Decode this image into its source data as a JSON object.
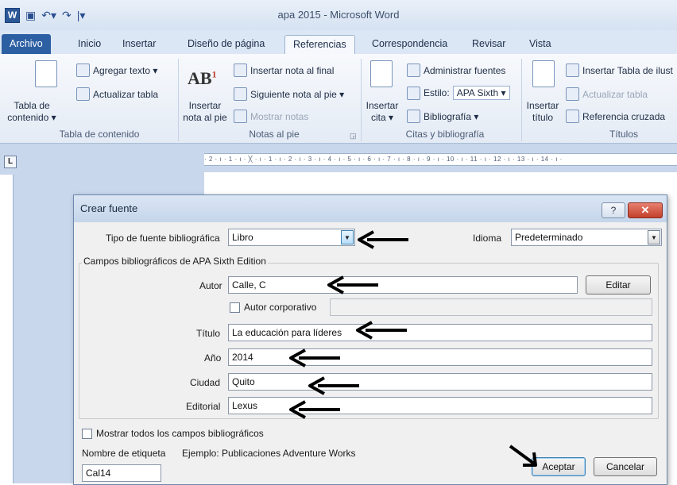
{
  "window": {
    "title": "apa 2015 - Microsoft Word"
  },
  "tabs": [
    {
      "label": "Archivo"
    },
    {
      "label": "Inicio"
    },
    {
      "label": "Insertar"
    },
    {
      "label": "Diseño de página"
    },
    {
      "label": "Referencias"
    },
    {
      "label": "Correspondencia"
    },
    {
      "label": "Revisar"
    },
    {
      "label": "Vista"
    }
  ],
  "ribbon": {
    "toc": {
      "big_line1": "Tabla de",
      "big_line2": "contenido ▾",
      "add_text": "Agregar texto ▾",
      "update_table": "Actualizar tabla",
      "group": "Tabla de contenido"
    },
    "footnotes": {
      "ab": "AB",
      "ab_sup": "1",
      "insert_line1": "Insertar",
      "insert_line2": "nota al pie",
      "insert_endnote": "Insertar nota al final",
      "next_footnote": "Siguiente nota al pie ▾",
      "show_notes": "Mostrar notas",
      "group": "Notas al pie"
    },
    "citations": {
      "insert_line1": "Insertar",
      "insert_line2": "cita ▾",
      "manage_sources": "Administrar fuentes",
      "style_label": "Estilo:",
      "style_value": "APA Sixth",
      "bibliography": "Bibliografía ▾",
      "group": "Citas y bibliografía"
    },
    "captions": {
      "insert_line1": "Insertar",
      "insert_line2": "título",
      "insert_table": "Insertar Tabla de ilust",
      "update_table": "Actualizar tabla",
      "cross_ref": "Referencia cruzada",
      "group": "Títulos"
    }
  },
  "ruler": {
    "corner": "L",
    "marks": "· 2 · ı · 1 · ı · ╳ · ı · 1 · ı · 2 · ı · 3 · ı · 4 · ı · 5 · ı · 6 · ı · 7 · ı · 8 · ı · 9 · ı · 10 · ı · 11 · ı · 12 · ı · 13 · ı · 14 · ı ·"
  },
  "dialog": {
    "title": "Crear fuente",
    "help": "?",
    "close": "✕",
    "source_type_label": "Tipo de fuente bibliográfica",
    "source_type_value": "Libro",
    "language_label": "Idioma",
    "language_value": "Predeterminado",
    "fields_group": "Campos bibliográficos de APA Sixth Edition",
    "author_label": "Autor",
    "author_value": "Calle, C",
    "edit_button": "Editar",
    "corporate_label": "Autor corporativo",
    "title_label": "Título",
    "title_value": "La educación para líderes",
    "year_label": "Año",
    "year_value": "2014",
    "city_label": "Ciudad",
    "city_value": "Quito",
    "publisher_label": "Editorial",
    "publisher_value": "Lexus",
    "show_all_label": "Mostrar todos los campos bibliográficos",
    "tag_label": "Nombre de etiqueta",
    "example_text": "Ejemplo: Publicaciones Adventure Works",
    "tag_value": "Cal14",
    "ok_button": "Aceptar",
    "cancel_button": "Cancelar"
  },
  "colors": {
    "arrow": "#000000",
    "file_tab": "#2d5fa3",
    "close_button": "#c2402b"
  }
}
